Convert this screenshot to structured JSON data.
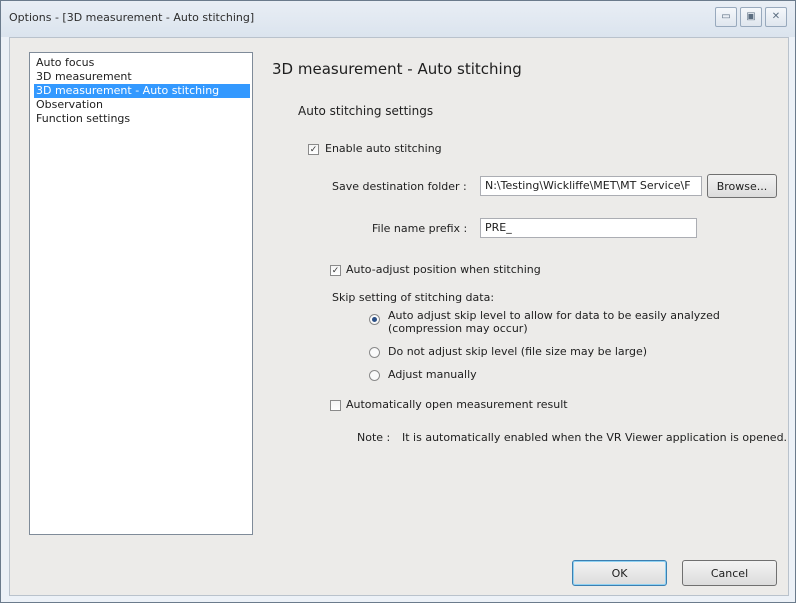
{
  "window": {
    "title": "Options - [3D measurement - Auto stitching]",
    "caption_buttons": {
      "minimize": "▭",
      "maximize": "▣",
      "close": "✕"
    }
  },
  "sidebar": {
    "items": [
      {
        "label": "Auto focus",
        "selected": false
      },
      {
        "label": "3D measurement",
        "selected": false
      },
      {
        "label": "3D measurement - Auto stitching",
        "selected": true
      },
      {
        "label": "Observation",
        "selected": false
      },
      {
        "label": "Function settings",
        "selected": false
      }
    ]
  },
  "page": {
    "title": "3D measurement - Auto stitching",
    "section_title": "Auto stitching settings"
  },
  "settings": {
    "enable_auto_stitching": {
      "label": "Enable auto stitching",
      "checked": true
    },
    "save_folder": {
      "label": "Save destination folder :",
      "value": "N:\\Testing\\Wickliffe\\MET\\MT Service\\F",
      "browse_label": "Browse..."
    },
    "file_prefix": {
      "label": "File name prefix :",
      "value": "PRE_"
    },
    "auto_adjust_position": {
      "label": "Auto-adjust position when stitching",
      "checked": true
    },
    "skip_setting": {
      "label": "Skip setting of stitching data:",
      "options": [
        {
          "line1": "Auto adjust skip level to allow for data to be easily analyzed",
          "line2": "(compression may occur)",
          "selected": true
        },
        {
          "line1": "Do not adjust skip level (file size may be large)",
          "selected": false
        },
        {
          "line1": "Adjust manually",
          "selected": false
        }
      ]
    },
    "auto_open_result": {
      "label": "Automatically open measurement result",
      "checked": false
    },
    "note": {
      "label": "Note :",
      "text": "It is automatically enabled when the VR Viewer application is opened."
    }
  },
  "buttons": {
    "ok": "OK",
    "cancel": "Cancel"
  },
  "colors": {
    "selection": "#3399ff",
    "title_bar": "#dbe4ee",
    "dialog_bg": "#ecebe9"
  },
  "icons": {
    "checkbox_checked": "check-icon"
  }
}
